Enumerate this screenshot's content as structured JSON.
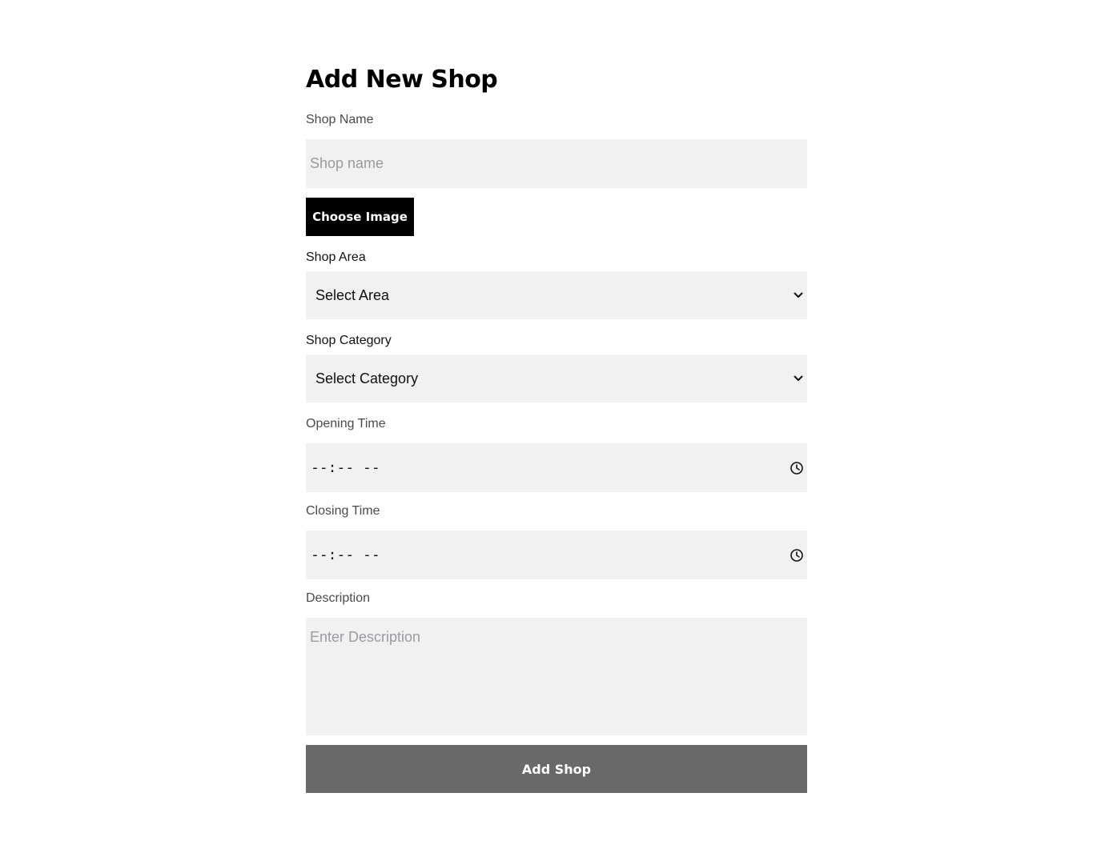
{
  "form": {
    "title": "Add New Shop",
    "shop_name": {
      "label": "Shop Name",
      "placeholder": "Shop name",
      "value": ""
    },
    "choose_image_label": "Choose Image",
    "shop_area": {
      "label": "Shop Area",
      "selected": "Select Area"
    },
    "shop_category": {
      "label": "Shop Category",
      "selected": "Select Category"
    },
    "opening_time": {
      "label": "Opening Time",
      "value": "--:-- --"
    },
    "closing_time": {
      "label": "Closing Time",
      "value": "--:-- --"
    },
    "description": {
      "label": "Description",
      "placeholder": "Enter Description",
      "value": ""
    },
    "submit_label": "Add Shop"
  },
  "colors": {
    "field_bg": "#f1f1f1",
    "primary_button": "#000000",
    "submit_button": "#696969",
    "label_text": "#4a4a4a"
  },
  "icons": {
    "select_chevron": "chevron-down-icon",
    "time_picker": "clock-icon"
  }
}
